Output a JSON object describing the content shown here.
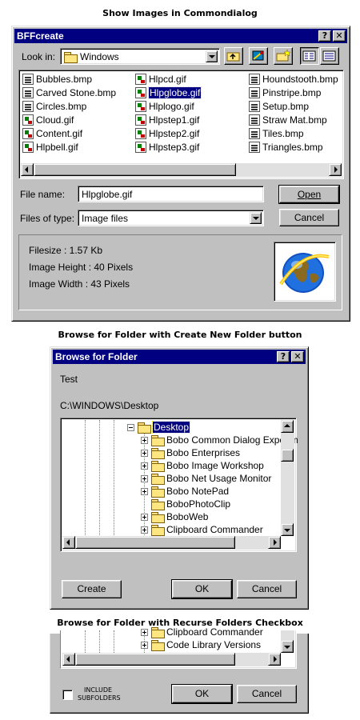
{
  "captions": {
    "first": "Show Images in Commondialog",
    "second": "Browse for Folder with Create New Folder button",
    "third": "Browse for Folder with Recurse Folders Checkbox"
  },
  "open_dialog": {
    "title": "BFFcreate",
    "help_label": "?",
    "close_label": "✕",
    "look_in_label": "Look in:",
    "look_in_value": "Windows",
    "files": [
      [
        "Bubbles.bmp",
        "Carved Stone.bmp",
        "Circles.bmp",
        "Cloud.gif",
        "Content.gif",
        "Hlpbell.gif"
      ],
      [
        "Hlpcd.gif",
        "Hlpglobe.gif",
        "Hlplogo.gif",
        "Hlpstep1.gif",
        "Hlpstep2.gif",
        "Hlpstep3.gif"
      ],
      [
        "Houndstooth.bmp",
        "Pinstripe.bmp",
        "Setup.bmp",
        "Straw Mat.bmp",
        "Tiles.bmp",
        "Triangles.bmp"
      ]
    ],
    "selected_file": "Hlpglobe.gif",
    "file_name_label": "File name:",
    "file_name_value": "Hlpglobe.gif",
    "files_of_type_label": "Files of type:",
    "files_of_type_value": "Image files",
    "open_label": "Open",
    "cancel_label": "Cancel",
    "info": {
      "filesize": "Filesize : 1.57 Kb",
      "height": "Image Height : 40 Pixels",
      "width": "Image Width : 43 Pixels"
    }
  },
  "browse_dialog": {
    "title": "Browse for Folder",
    "help_label": "?",
    "close_label": "✕",
    "prompt": "Test",
    "path": "C:\\WINDOWS\\Desktop",
    "root": "Desktop",
    "folders": [
      {
        "name": "Bobo Common Dialog Experim",
        "expandable": true
      },
      {
        "name": "Bobo Enterprises",
        "expandable": true
      },
      {
        "name": "Bobo Image Workshop",
        "expandable": true
      },
      {
        "name": "Bobo Net Usage Monitor",
        "expandable": true
      },
      {
        "name": "Bobo NotePad",
        "expandable": true
      },
      {
        "name": "BoboPhotoClip",
        "expandable": false
      },
      {
        "name": "BoboWeb",
        "expandable": true
      },
      {
        "name": "Clipboard Commander",
        "expandable": true
      },
      {
        "name": "Code Library Versions",
        "expandable": true
      }
    ],
    "create_label": "Create",
    "ok_label": "OK",
    "cancel_label": "Cancel"
  },
  "recurse_dialog": {
    "folders": [
      "Clipboard Commander",
      "Code Library Versions"
    ],
    "include_label_1": "INCLUDE",
    "include_label_2": "SUBFOLDERS",
    "ok_label": "OK",
    "cancel_label": "Cancel"
  }
}
